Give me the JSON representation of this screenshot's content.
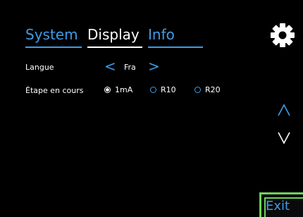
{
  "tabs": [
    {
      "label": "System"
    },
    {
      "label": "Display"
    },
    {
      "label": "Info"
    }
  ],
  "active_tab": "Display",
  "settings": {
    "language": {
      "label": "Langue",
      "value": "Fra",
      "prev_symbol": "<",
      "next_symbol": ">"
    },
    "step": {
      "label": "Étape en cours",
      "options": [
        {
          "label": "1mA",
          "selected": true
        },
        {
          "label": "R10",
          "selected": false
        },
        {
          "label": "R20",
          "selected": false
        }
      ]
    }
  },
  "controls": {
    "exit_label": "Exit"
  },
  "icons": {
    "settings": "gear-icon",
    "scroll_up": "chevron-up-icon",
    "scroll_down": "chevron-down-icon"
  },
  "colors": {
    "background": "#000000",
    "accent_blue": "#3f9be6",
    "text": "#ffffff",
    "exit_border": "#6fd25a"
  }
}
